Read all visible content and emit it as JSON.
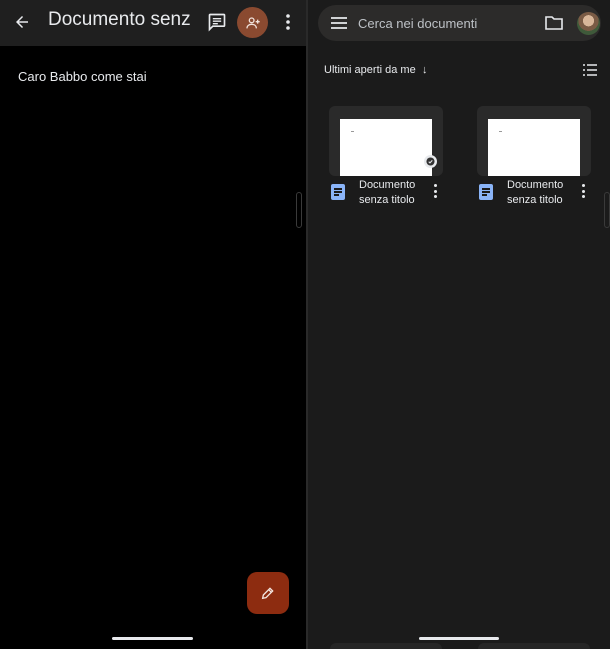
{
  "editor": {
    "title": "Documento senza titolo",
    "body_text": "Caro Babbo come stai",
    "colors": {
      "share_button": "#8a4a30",
      "fab": "#8d2c10"
    },
    "icons": [
      "back-arrow-icon",
      "comment-icon",
      "add-person-icon",
      "more-vert-icon",
      "edit-pencil-icon"
    ]
  },
  "docs": {
    "search": {
      "placeholder": "Cerca nei documenti"
    },
    "sort_label": "Ultimi aperti da me",
    "sort_arrow": "↓",
    "files": [
      {
        "name": "Documento senza titolo",
        "offline": true
      },
      {
        "name": "Documento senza titolo",
        "offline": false
      }
    ],
    "colors": {
      "doc_icon": "#8ab4f8"
    },
    "icons": [
      "menu-icon",
      "folder-icon",
      "list-view-icon",
      "docs-file-icon",
      "more-vert-icon",
      "offline-check-icon"
    ]
  }
}
